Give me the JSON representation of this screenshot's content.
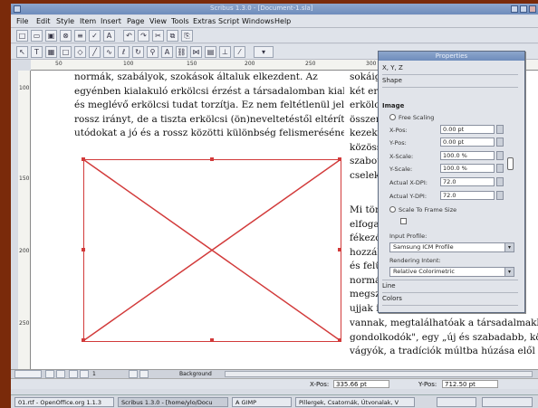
{
  "window": {
    "title": "Scribus 1.3.0 - [Document-1.sla]"
  },
  "menu": [
    "File",
    "Edit",
    "Style",
    "Item",
    "Insert",
    "Page",
    "View",
    "Tools",
    "Extras",
    "Script",
    "Windows",
    "Help"
  ],
  "ruler": {
    "top": [
      "50",
      "100",
      "150",
      "200",
      "250",
      "300",
      "350"
    ],
    "left": [
      "100",
      "150",
      "200",
      "250"
    ]
  },
  "text_left": [
    "normák, szabályok, szokások általuk elkezdent. Az",
    "egyénben kialakuló erkölcsi érzést a társadalomban kialakult",
    "és meglévő erkölcsi tudat torzítja. Ez nem feltétlenül jelent",
    "rossz irányt, de a tiszta erkölcsi (ön)neveltetéstől eltérít. Az",
    "utódokat a jó és a rossz közötti különbség felismerésének"
  ],
  "text_right_top": [
    "sokáig",
    "két erkö",
    "erkölcsi",
    "összenő",
    "kezekké",
    "közösség",
    "szabotta",
    "cselekv"
  ],
  "text_right_mid": [
    "Mi tört",
    "elfogad",
    "fékezőv",
    "hozzáka",
    "és felü",
    "normár",
    "megszü",
    "ujjak is"
  ],
  "text_bottom": [
    "vannak, megtalálhatóak a társadalmakban",
    "gondolkodók\", egy „új és szabadabb, köt",
    "vágyók, a tradíciók múltba húzása elől n"
  ],
  "properties": {
    "title": "Properties",
    "sections": [
      "X, Y, Z",
      "Shape",
      "Image"
    ],
    "free_scaling": "Free Scaling",
    "fields": [
      {
        "label": "X-Pos:",
        "value": "0.00 pt"
      },
      {
        "label": "Y-Pos:",
        "value": "0.00 pt"
      },
      {
        "label": "X-Scale:",
        "value": "100.0 %"
      },
      {
        "label": "Y-Scale:",
        "value": "100.0 %"
      },
      {
        "label": "Actual X-DPI:",
        "value": "72.0"
      },
      {
        "label": "Actual Y-DPI:",
        "value": "72.0"
      }
    ],
    "scale_to_frame": "Scale To Frame Size",
    "input_profile_label": "Input Profile:",
    "input_profile": "Samsung ICM Profile",
    "rendering_intent_label": "Rendering Intent:",
    "rendering_intent": "Relative Colorimetric",
    "bottom_sections": [
      "Line",
      "Colors"
    ]
  },
  "status": {
    "xpos_label": "X-Pos:",
    "xpos": "335.66 pt",
    "ypos_label": "Y-Pos:",
    "ypos": "712.50 pt"
  },
  "bottom_toolbar": {
    "zoom": "100.00 %",
    "page": "1",
    "layer": "Background"
  },
  "taskbar": [
    "01.rtf - OpenOffice.org 1.1.3",
    "Scribus 1.3.0 - [home/ylo/Docu",
    "A GIMP",
    "Pillergek, Csatornák, Útvonalak, V"
  ]
}
